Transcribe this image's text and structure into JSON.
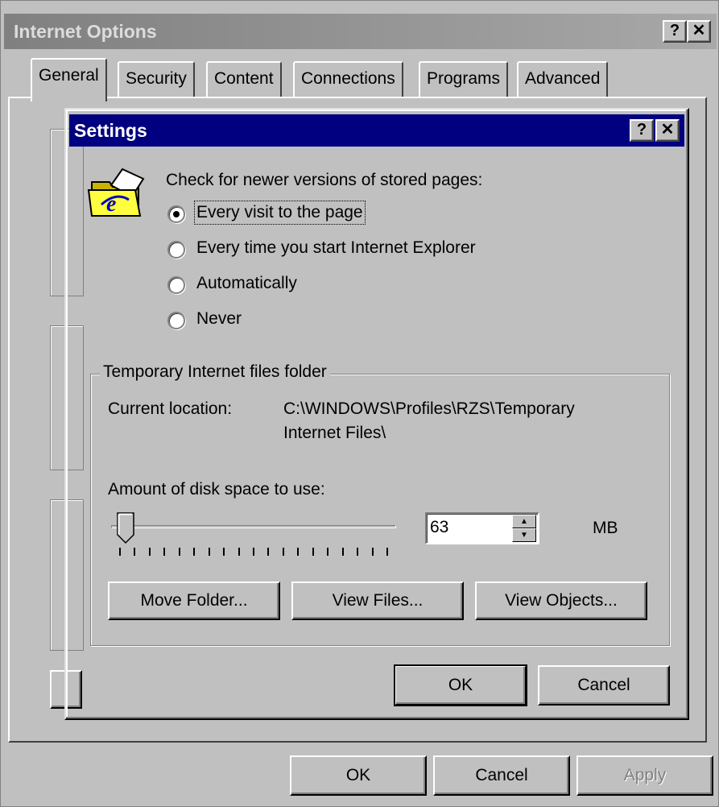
{
  "outer": {
    "title": "Internet Options",
    "help_btn": "?",
    "close_btn": "✕",
    "tabs": [
      "General",
      "Security",
      "Content",
      "Connections",
      "Programs",
      "Advanced"
    ],
    "ok_label": "OK",
    "cancel_label": "Cancel",
    "apply_label": "Apply"
  },
  "settings": {
    "title": "Settings",
    "help_btn": "?",
    "close_btn": "✕",
    "check_label": "Check for newer versions of stored pages:",
    "options": [
      {
        "label": "Every visit to the page",
        "selected": true
      },
      {
        "label": "Every time you start Internet Explorer",
        "selected": false
      },
      {
        "label": "Automatically",
        "selected": false
      },
      {
        "label": "Never",
        "selected": false
      }
    ],
    "group_title": "Temporary Internet files folder",
    "current_location_label": "Current location:",
    "current_location_value_line1": "C:\\WINDOWS\\Profiles\\RZS\\Temporary",
    "current_location_value_line2": "Internet Files\\",
    "disk_space_label": "Amount of disk space to use:",
    "disk_space_value": "63",
    "disk_space_unit": "MB",
    "slider_fraction": 0.02,
    "move_folder_label": "Move Folder...",
    "view_files_label": "View Files...",
    "view_objects_label": "View Objects...",
    "ok_label": "OK",
    "cancel_label": "Cancel"
  }
}
